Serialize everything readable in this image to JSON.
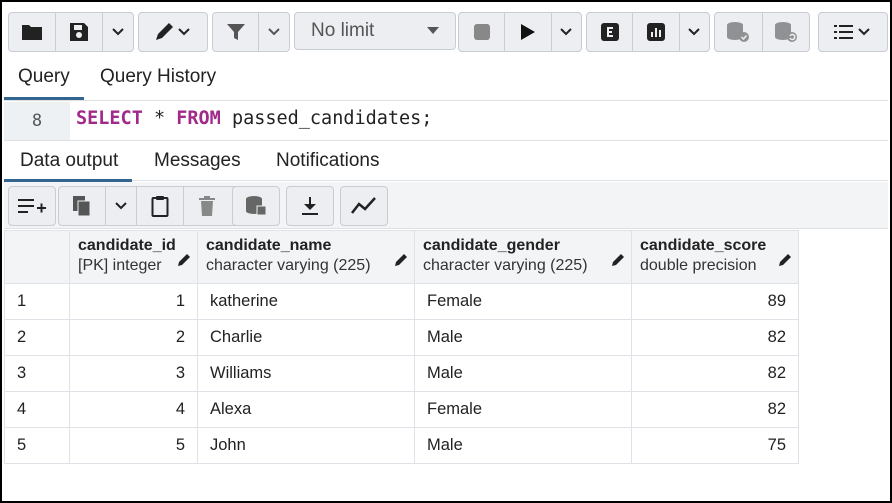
{
  "toolbar": {
    "limit_select": "No limit"
  },
  "query_tabs": [
    {
      "label": "Query",
      "active": true
    },
    {
      "label": "Query History",
      "active": false
    }
  ],
  "editor": {
    "line_number": "8",
    "keyword_select": "SELECT",
    "star": " * ",
    "keyword_from": "FROM",
    "rest": " passed_candidates;"
  },
  "output_tabs": [
    {
      "label": "Data output",
      "active": true
    },
    {
      "label": "Messages",
      "active": false
    },
    {
      "label": "Notifications",
      "active": false
    }
  ],
  "columns": [
    {
      "name": "candidate_id",
      "type": "[PK] integer"
    },
    {
      "name": "candidate_name",
      "type": "character varying (225)"
    },
    {
      "name": "candidate_gender",
      "type": "character varying (225)"
    },
    {
      "name": "candidate_score",
      "type": "double precision"
    }
  ],
  "rows": [
    {
      "n": "1",
      "id": "1",
      "name": "katherine",
      "gender": "Female",
      "score": "89"
    },
    {
      "n": "2",
      "id": "2",
      "name": "Charlie",
      "gender": "Male",
      "score": "82"
    },
    {
      "n": "3",
      "id": "3",
      "name": "Williams",
      "gender": "Male",
      "score": "82"
    },
    {
      "n": "4",
      "id": "4",
      "name": "Alexa",
      "gender": "Female",
      "score": "82"
    },
    {
      "n": "5",
      "id": "5",
      "name": "John",
      "gender": "Male",
      "score": "75"
    }
  ]
}
